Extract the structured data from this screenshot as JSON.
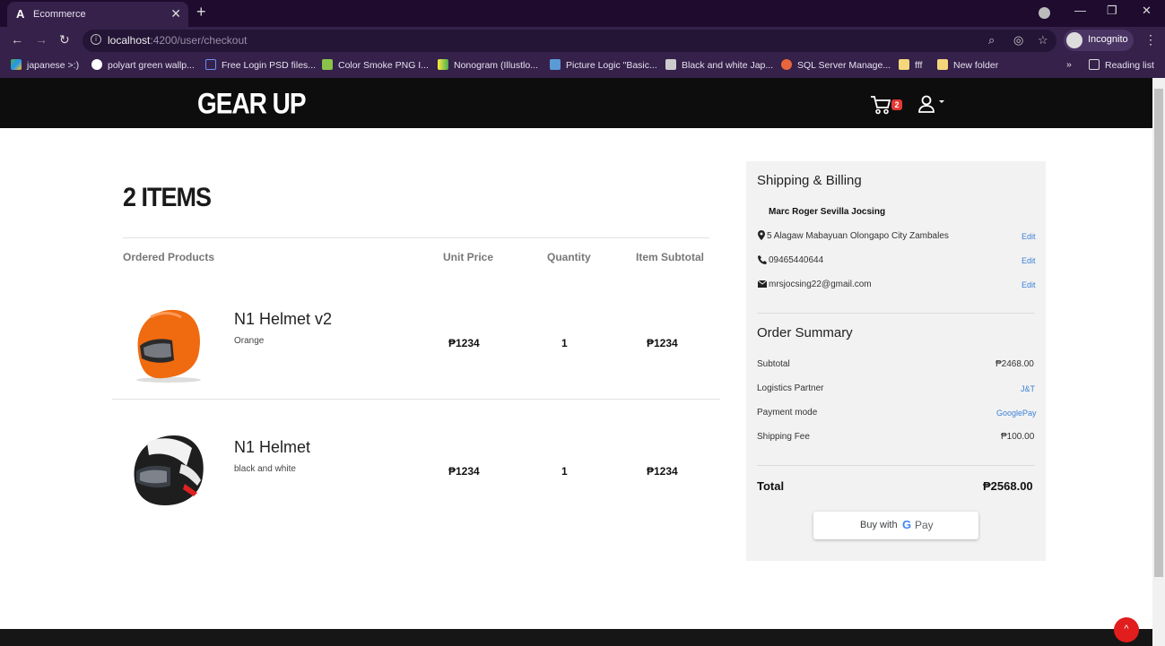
{
  "browser": {
    "tab_title": "Ecommerce",
    "tab_favicon": "A",
    "new_tab": "+",
    "url_host": "localhost",
    "url_rest": ":4200/user/checkout",
    "profile": "Incognito",
    "bookmarks": [
      "japanese >:)",
      "polyart green wallp...",
      "Free Login PSD files...",
      "Color Smoke PNG I...",
      "Nonogram (Illustlo...",
      "Picture Logic \"Basic...",
      "Black and white Jap...",
      "SQL Server Manage...",
      "fff",
      "New folder"
    ],
    "more_bookmarks": "»",
    "reading_list": "Reading list"
  },
  "header": {
    "logo": "GEAR UP",
    "cart_count": "2"
  },
  "cart": {
    "title": "2 ITEMS",
    "columns": {
      "product": "Ordered Products",
      "unit_price": "Unit Price",
      "quantity": "Quantity",
      "subtotal": "Item Subtotal"
    },
    "items": [
      {
        "name": "N1 Helmet v2",
        "variant": "Orange",
        "unit_price": "₱1234",
        "quantity": "1",
        "subtotal": "₱1234",
        "color": "#f06a10"
      },
      {
        "name": "N1 Helmet",
        "variant": "black and white",
        "unit_price": "₱1234",
        "quantity": "1",
        "subtotal": "₱1234",
        "color": "#222222"
      }
    ]
  },
  "shipping": {
    "title": "Shipping & Billing",
    "name": "Marc Roger Sevilla Jocsing",
    "address": "5 Alagaw Mabayuan Olongapo City Zambales",
    "phone": "09465440644",
    "email": "mrsjocsing22@gmail.com",
    "edit_label": "Edit"
  },
  "summary": {
    "title": "Order Summary",
    "subtotal_label": "Subtotal",
    "subtotal": "₱2468.00",
    "logistics_label": "Logistics Partner",
    "logistics": "J&T",
    "payment_label": "Payment mode",
    "payment": "GooglePay",
    "shipping_label": "Shipping Fee",
    "shipping": "₱100.00",
    "total_label": "Total",
    "total": "₱2568.00",
    "buy_label": "Buy with",
    "g_letter": "G",
    "pay_word": "Pay"
  },
  "colors": {
    "accent_link": "#3c82d8",
    "header_bg": "#0d0d0d",
    "badge": "#e53935",
    "browser_frame": "#35214a"
  }
}
